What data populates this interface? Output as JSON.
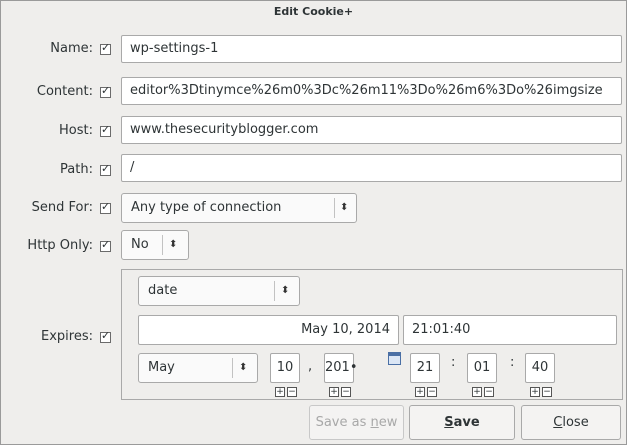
{
  "window": {
    "title": "Edit Cookie+"
  },
  "fields": {
    "name": {
      "label": "Name:",
      "value": "wp-settings-1"
    },
    "content": {
      "label": "Content:",
      "value": "editor%3Dtinymce%26m0%3Dc%26m11%3Do%26m6%3Do%26imgsize"
    },
    "host": {
      "label": "Host:",
      "value": "www.thesecurityblogger.com"
    },
    "path": {
      "label": "Path:",
      "value": "/"
    },
    "send_for": {
      "label": "Send For:",
      "value": "Any type of connection"
    },
    "http_only": {
      "label": "Http Only:",
      "value": "No"
    },
    "expires": {
      "label": "Expires:",
      "mode": "date",
      "date_text": "May 10, 2014",
      "time_text": "21:01:40",
      "month": "May",
      "day": "10",
      "year": "201•",
      "hour": "21",
      "minute": "01",
      "second": "40",
      "date_sep": ",",
      "time_sep": ":"
    }
  },
  "buttons": {
    "save_as_new": {
      "pre": "Save as ",
      "acc": "n",
      "post": "ew"
    },
    "save": {
      "acc": "S",
      "post": "ave"
    },
    "close": {
      "acc": "C",
      "post": "lose"
    }
  },
  "icons": {
    "check": "check-icon",
    "dropdown": "up-down-arrow-icon",
    "calendar": "calendar-icon",
    "plus": "plus-icon",
    "minus": "minus-icon"
  }
}
